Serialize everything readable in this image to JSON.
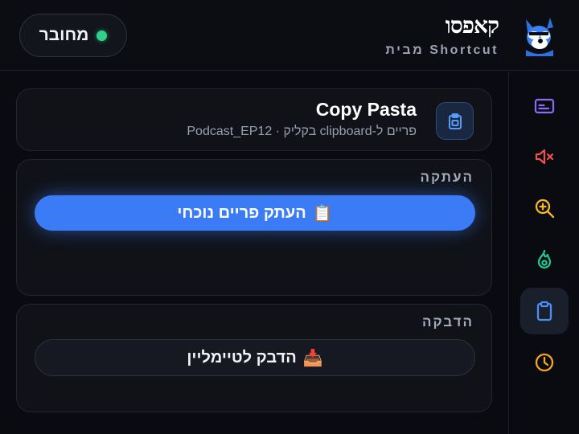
{
  "header": {
    "connection_label": "מחובר",
    "connection_color": "#2fd08a",
    "brand_logo_text": "קאפסו",
    "brand_subtitle": "מבית Shortcut"
  },
  "sidebar": {
    "items": [
      {
        "icon": "captions-icon",
        "color": "#8b6cf6",
        "active": false
      },
      {
        "icon": "mute-icon",
        "color": "#ef5350",
        "active": false
      },
      {
        "icon": "zoom-in-icon",
        "color": "#f5b829",
        "active": false
      },
      {
        "icon": "flame-icon",
        "color": "#22c58e",
        "active": false
      },
      {
        "icon": "clipboard-icon",
        "color": "#4b8ef7",
        "active": true
      },
      {
        "icon": "clock-icon",
        "color": "#f5a623",
        "active": false
      }
    ]
  },
  "tool": {
    "title": "Copy Pasta",
    "description": "פריים ל-clipboard בקליק · Podcast_EP12",
    "icon": "clipboard-icon"
  },
  "copy_section": {
    "label": "העתקה",
    "button_label": "העתק פריים נוכחי",
    "button_emoji": "📋"
  },
  "paste_section": {
    "label": "הדבקה",
    "button_label": "הדבק לטיימליין",
    "button_emoji": "📥"
  },
  "colors": {
    "accent": "#3b7cf6",
    "background": "#0a0b10"
  }
}
